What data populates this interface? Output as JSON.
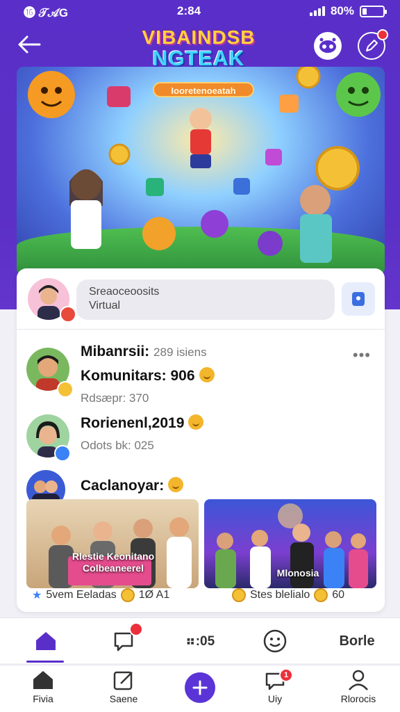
{
  "status_bar": {
    "left": "⓰ 𝒯𝒜G",
    "time": "2:84",
    "battery": "80%"
  },
  "header": {
    "logo_line1": "VIBAINDSB",
    "logo_line2": "NGTEAK",
    "hero_tag": "Iooretenoeatah"
  },
  "composer": {
    "placeholder_line1": "Sreaoceoosits",
    "placeholder_line2": "Virtual"
  },
  "feed": [
    {
      "title": "Mibanrsii:",
      "title_muted": "289 isiens",
      "line2": "Komunitars: 906",
      "sub": "Rdsæpr: 370"
    },
    {
      "title": "Rorienenl,2019",
      "sub": "Odots bk: 025"
    },
    {
      "title": "Caclanoyar:"
    }
  ],
  "thumbnails": [
    {
      "label_l1": "Rlestie Keonitano",
      "label_l2": "Colbeaneerel",
      "meta": "5vem Eeladas",
      "count": "1Ø A1"
    },
    {
      "label_l1": "Mlonosia",
      "meta": "Stes blelialo",
      "count": "60"
    }
  ],
  "tabs": {
    "time_tab": "⠶:05",
    "last_tab": "Borle"
  },
  "bottom_nav": [
    {
      "label": "Fivia"
    },
    {
      "label": "Saene"
    },
    {
      "label": "Uiy",
      "badge": "1"
    },
    {
      "label": "Rlorocis"
    }
  ],
  "colors": {
    "brand": "#5a2fc9",
    "accent_red": "#ec2f3b",
    "fab": "#5a34d6"
  }
}
